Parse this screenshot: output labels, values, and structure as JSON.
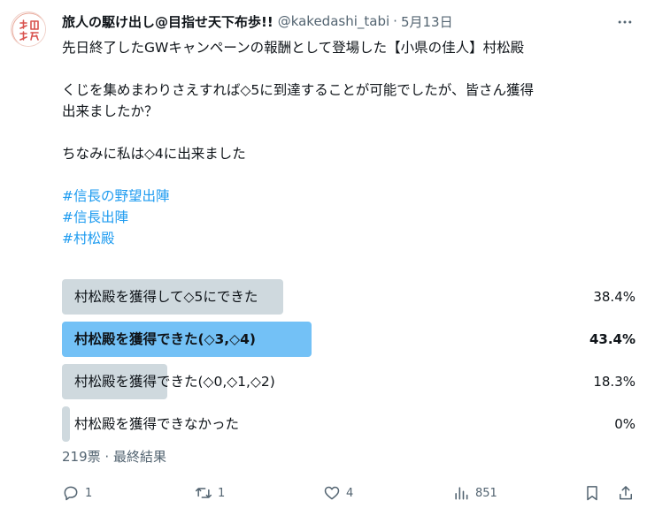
{
  "tweet": {
    "author_name": "旅人の駆け出し@目指せ天下布歩!!",
    "handle": "@kakedashi_tabi",
    "separator": "·",
    "date": "5月13日",
    "lines": [
      "先日終了したGWキャンペーンの報酬として登場した【小県の佳人】村松殿",
      "",
      "くじを集めまわりさえすれば◇5に到達することが可能でしたが、皆さん獲得",
      "出来ましたか？",
      "",
      "ちなみに私は◇4に出来ました"
    ],
    "hashtags": [
      "#信長の野望出陣",
      "#信長出陣",
      "#村松殿"
    ]
  },
  "poll": {
    "options": [
      {
        "label": "村松殿を獲得して◇5にできた",
        "percent_text": "38.4%",
        "percent": 38.4,
        "winner": false
      },
      {
        "label": "村松殿を獲得できた(◇3,◇4)",
        "percent_text": "43.4%",
        "percent": 43.4,
        "winner": true
      },
      {
        "label": "村松殿を獲得できた(◇0,◇1,◇2)",
        "percent_text": "18.3%",
        "percent": 18.3,
        "winner": false
      },
      {
        "label": "村松殿を獲得できなかった",
        "percent_text": "0%",
        "percent": 0,
        "winner": false
      }
    ],
    "votes_text": "219票",
    "separator": "·",
    "status_text": "最終結果",
    "colors": {
      "bar": "#cfd9de",
      "winner_bar": "#73c1f6",
      "hashtag": "#1d9bf0"
    }
  },
  "actions": {
    "reply_count": "1",
    "retweet_count": "1",
    "like_count": "4",
    "view_count": "851",
    "icons": [
      "reply-icon",
      "retweet-icon",
      "like-icon",
      "views-icon",
      "bookmark-icon",
      "share-icon"
    ]
  },
  "avatar_text": "旅人出版"
}
